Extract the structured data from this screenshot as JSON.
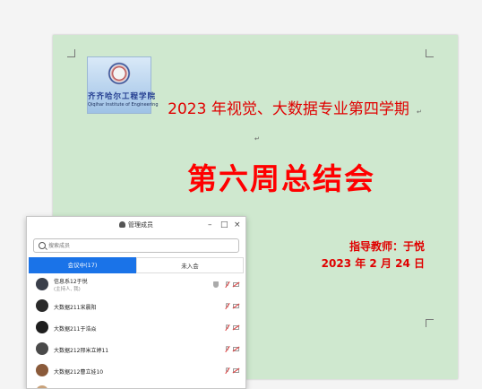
{
  "document": {
    "logo": {
      "name_cn": "齐齐哈尔工程学院",
      "name_en": "Qiqihar Institute of Engineering"
    },
    "title": "2023 年视觉、大数据专业第四学期",
    "subtitle": "第六周总结会",
    "teacher": "指导教师：于悦",
    "date": "2023 年 2 月 24 日"
  },
  "dialog": {
    "title": "管理成员",
    "search_placeholder": "搜索成员",
    "tabs": [
      {
        "label": "会议中(17)",
        "active": true
      },
      {
        "label": "未入会",
        "active": false
      }
    ],
    "members": [
      {
        "name": "信息系12于悦",
        "sub": "(主持人, 我)",
        "avatar_color": "#3a3f4a"
      },
      {
        "name": "大数据211宋晨阳",
        "sub": "",
        "avatar_color": "#2a2a2a"
      },
      {
        "name": "大数据211于浩焱",
        "sub": "",
        "avatar_color": "#1e1e1e"
      },
      {
        "name": "大数据212邢米立婷11",
        "sub": "",
        "avatar_color": "#4a4a4a"
      },
      {
        "name": "大数据212曹立娃10",
        "sub": "",
        "avatar_color": "#8a5a3a"
      },
      {
        "name": "",
        "sub": "",
        "avatar_color": "#c9a27a"
      }
    ]
  }
}
